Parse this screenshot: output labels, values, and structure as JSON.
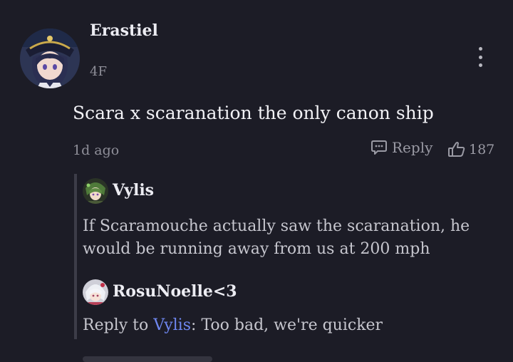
{
  "comment": {
    "author": "Erastiel",
    "floor": "4F",
    "text": "Scara x scaranation the only canon ship",
    "time": "1d ago",
    "reply_label": "Reply",
    "like_count": "187",
    "avatar_icon": "character-avatar",
    "more_icon": "vertical-ellipsis-icon"
  },
  "replies": [
    {
      "author": "Vylis",
      "text": "If Scaramouche actually saw the scaranation, he would be running away from us at 200 mph"
    },
    {
      "author": "RosuNoelle<3",
      "reply_prefix": "Reply to",
      "reply_target": "Vylis",
      "separator": ":",
      "text": "Too bad, we're quicker"
    }
  ],
  "colors": {
    "background": "#1c1c26",
    "mention": "#6f87f0",
    "muted_text": "#8e8e98"
  }
}
